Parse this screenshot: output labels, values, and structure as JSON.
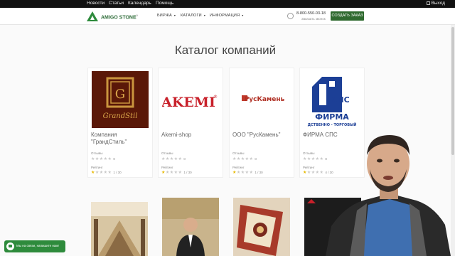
{
  "topnav": {
    "items": [
      "Новости",
      "Статьи",
      "Календарь",
      "Помощь"
    ],
    "logout": "Выход"
  },
  "header": {
    "logo": "AMIGO STONE",
    "logo_sup": "2",
    "nav": [
      "БИРЖА",
      "КАТАЛОГИ",
      "ИНФОРМАЦИЯ"
    ],
    "phone": "8-800-550-03-18",
    "callback": "Заказать звонок",
    "order_button": "СОЗДАТЬ ЗАКАЗ"
  },
  "page": {
    "title": "Каталог компаний"
  },
  "labels": {
    "reviews": "Отзывы",
    "rating": "Рейтинг"
  },
  "companies": [
    {
      "name": "Компания \"ГрандСтиль\"",
      "logo_text": "GrandStil",
      "reviews_stars": 0,
      "reviews_count": "0",
      "rating_stars": 1,
      "rating_count": "1 / 30"
    },
    {
      "name": "Akemi-shop",
      "logo_text": "AKEMI",
      "logo_mark": "®",
      "reviews_stars": 0,
      "reviews_count": "0",
      "rating_stars": 1,
      "rating_count": "1 / 30"
    },
    {
      "name": "ООО \"РусКамень\"",
      "logo_text": "РусКамень",
      "reviews_stars": 0,
      "reviews_count": "0",
      "rating_stars": 1,
      "rating_count": "1 / 30"
    },
    {
      "name": "ФИРМА СПС",
      "logo_text": "СПС",
      "logo_text2": "ФИРМА",
      "logo_text3": "ДСТВЕННО - ТОРГОВЫЙ",
      "reviews_stars": 0,
      "reviews_count": "0",
      "rating_stars": 1,
      "rating_count": "4 / 30"
    }
  ],
  "chat": {
    "text": "Мы на связи, напишите нам!"
  },
  "colors": {
    "brand_green": "#2e8b3c",
    "button_green": "#2f6a2f",
    "star_on": "#e6b800",
    "akemi_red": "#c8202a",
    "sps_blue": "#1c3f96"
  }
}
